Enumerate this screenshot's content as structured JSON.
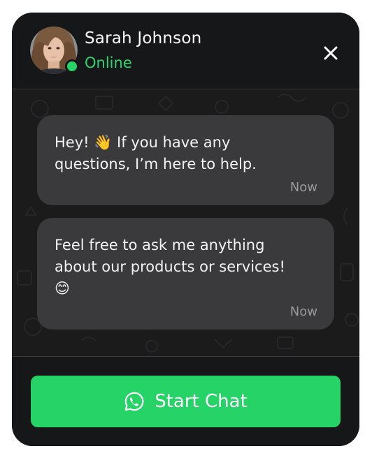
{
  "header": {
    "name": "Sarah Johnson",
    "status": "Online",
    "status_color": "#25d366"
  },
  "messages": [
    {
      "text": "Hey! 👋 If you have any\nquestions, I’m here to help.",
      "time": "Now"
    },
    {
      "text": "Feel free to ask me anything\nabout our products or services!\n😊",
      "time": "Now"
    }
  ],
  "footer": {
    "button_label": "Start Chat",
    "button_icon": "whatsapp-icon",
    "button_color": "#25d366"
  },
  "icons": {
    "close": "close-icon",
    "avatar": "avatar"
  },
  "theme": {
    "background": "#151617",
    "bubble": "#3a3a3c"
  }
}
